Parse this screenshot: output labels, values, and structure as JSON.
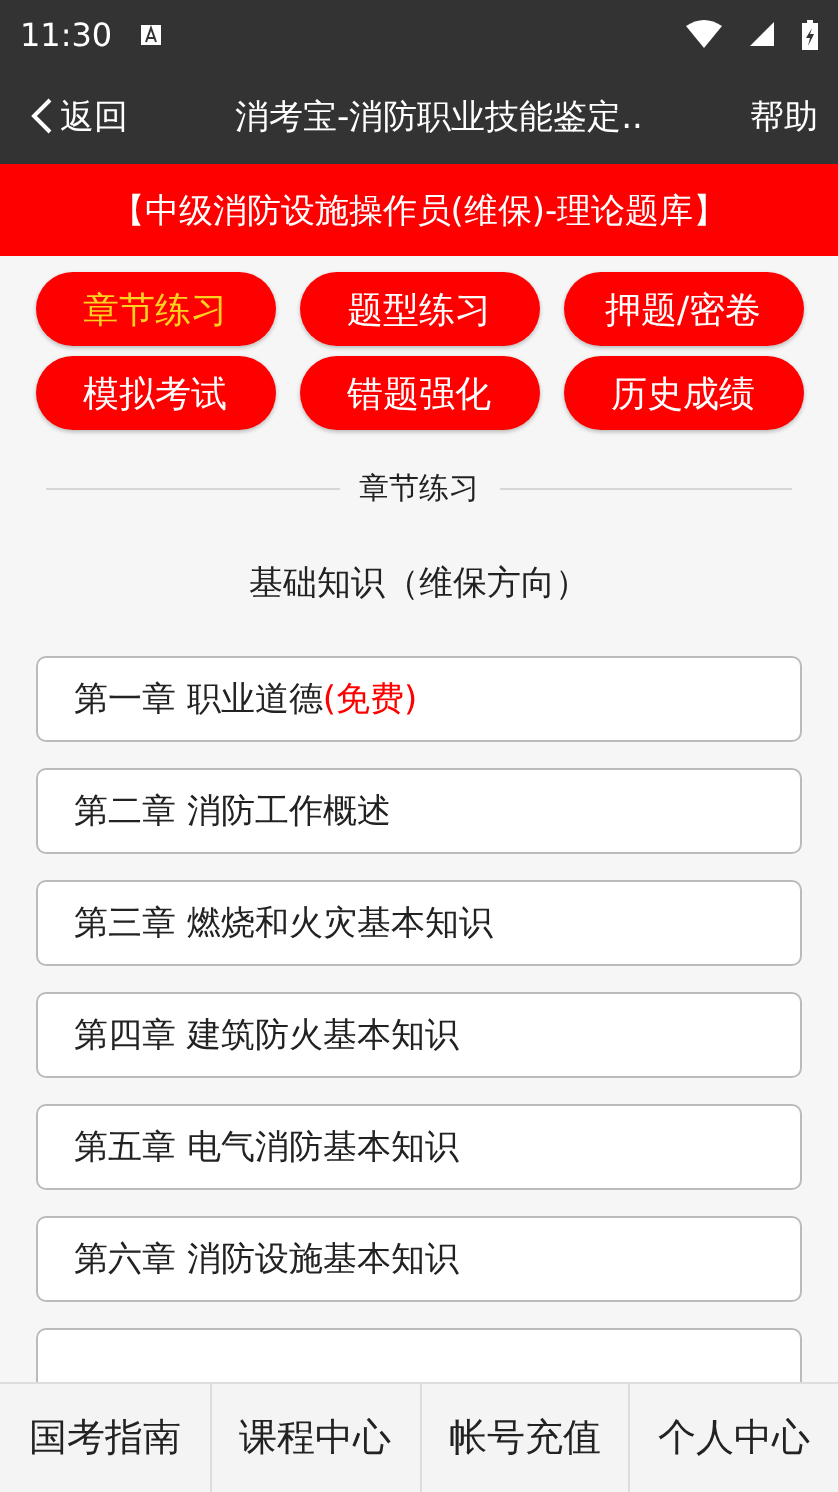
{
  "status_bar": {
    "time": "11:30"
  },
  "toolbar": {
    "back": "返回",
    "title": "消考宝-消防职业技能鉴定..",
    "help": "帮助"
  },
  "banner": "【中级消防设施操作员(维保)-理论题库】",
  "modes": [
    {
      "label": "章节练习",
      "selected": true
    },
    {
      "label": "题型练习",
      "selected": false
    },
    {
      "label": "押题/密卷",
      "selected": false
    },
    {
      "label": "模拟考试",
      "selected": false
    },
    {
      "label": "错题强化",
      "selected": false
    },
    {
      "label": "历史成绩",
      "selected": false
    }
  ],
  "section_title": "章节练习",
  "subtitle": "基础知识（维保方向）",
  "chapters": [
    {
      "title": "第一章 职业道德",
      "note": "(免费)"
    },
    {
      "title": "第二章 消防工作概述"
    },
    {
      "title": "第三章 燃烧和火灾基本知识"
    },
    {
      "title": "第四章 建筑防火基本知识"
    },
    {
      "title": "第五章 电气消防基本知识"
    },
    {
      "title": "第六章 消防设施基本知识"
    }
  ],
  "list_continues_below": true,
  "bottom_nav": [
    "国考指南",
    "课程中心",
    "帐号充值",
    "个人中心"
  ]
}
